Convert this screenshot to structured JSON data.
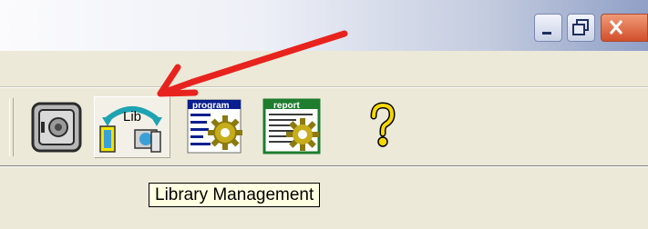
{
  "window": {
    "controls": [
      "minimize",
      "maximize",
      "close"
    ]
  },
  "toolbar": {
    "buttons": [
      {
        "icon": "safe-icon"
      },
      {
        "icon": "library-management-icon",
        "label_on_icon": "Lib",
        "state": "hovered"
      },
      {
        "icon": "program-gear-icon",
        "label_on_icon": "program"
      },
      {
        "icon": "report-gear-icon",
        "label_on_icon": "report"
      },
      {
        "icon": "help-icon"
      }
    ]
  },
  "tooltip": {
    "text": "Library Management"
  },
  "colors": {
    "annotation_arrow": "#e8231d",
    "tooltip_bg": "#ffffe1"
  }
}
